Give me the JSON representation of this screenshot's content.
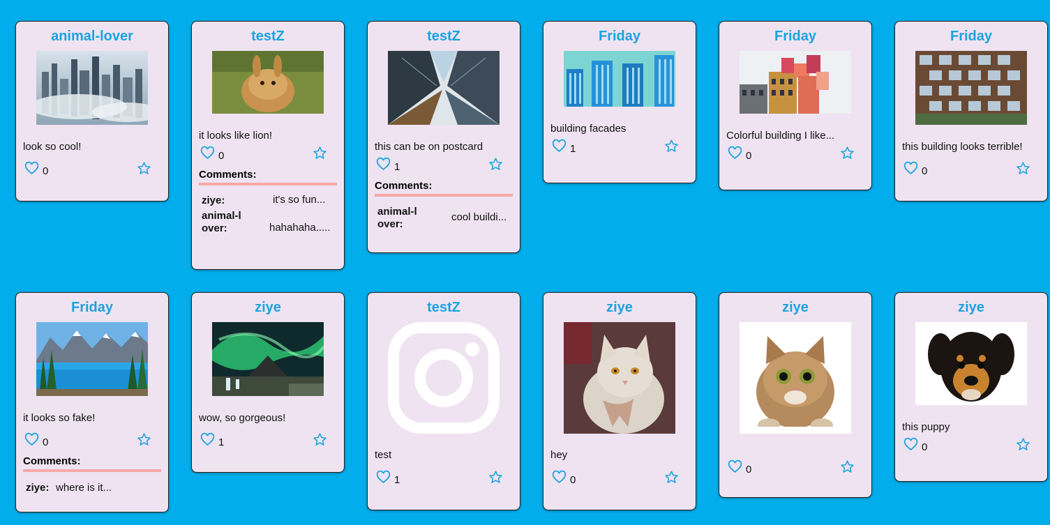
{
  "colors": {
    "background": "#02ADEB",
    "card": "#EFE3F1",
    "author": "#1AA3E0",
    "divider": "#F7A9A8"
  },
  "posts": [
    {
      "author": "animal-lover",
      "caption": "look so cool!",
      "likes": "0",
      "image": "foggy-city-skyline"
    },
    {
      "author": "testZ",
      "caption": "it looks like lion!",
      "likes": "0",
      "image": "fluffy-rabbit",
      "comments_label": "Comments:",
      "comments": [
        {
          "user": "ziye:",
          "text": "it's so fun..."
        },
        {
          "user": "animal-lover:",
          "text": "hahahaha....."
        }
      ]
    },
    {
      "author": "testZ",
      "caption": "this can be on postcard",
      "likes": "1",
      "image": "skyscrapers-from-below",
      "comments_label": "Comments:",
      "comments": [
        {
          "user": "animal-lover:",
          "text": "cool buildi..."
        }
      ]
    },
    {
      "author": "Friday",
      "caption": "building facades",
      "likes": "1",
      "image": "building-facades-illustration"
    },
    {
      "author": "Friday",
      "caption": "Colorful building I like...",
      "likes": "0",
      "image": "colorful-building"
    },
    {
      "author": "Friday",
      "caption": "this building looks terrible!",
      "likes": "0",
      "image": "honeycomb-building"
    },
    {
      "author": "Friday",
      "caption": "it looks so fake!",
      "likes": "0",
      "image": "mountain-lake",
      "comments_label": "Comments:",
      "comments": [
        {
          "user": "ziye:",
          "text": "where is it..."
        }
      ]
    },
    {
      "author": "ziye",
      "caption": "wow, so gorgeous!",
      "likes": "1",
      "image": "northern-lights"
    },
    {
      "author": "testZ",
      "caption": "test",
      "likes": "1",
      "image": "instagram-logo"
    },
    {
      "author": "ziye",
      "caption": "hey",
      "likes": "0",
      "image": "white-cat-with-scarf"
    },
    {
      "author": "ziye",
      "caption": "",
      "likes": "0",
      "image": "tabby-cat"
    },
    {
      "author": "ziye",
      "caption": "this puppy",
      "likes": "0",
      "image": "puppy"
    }
  ]
}
